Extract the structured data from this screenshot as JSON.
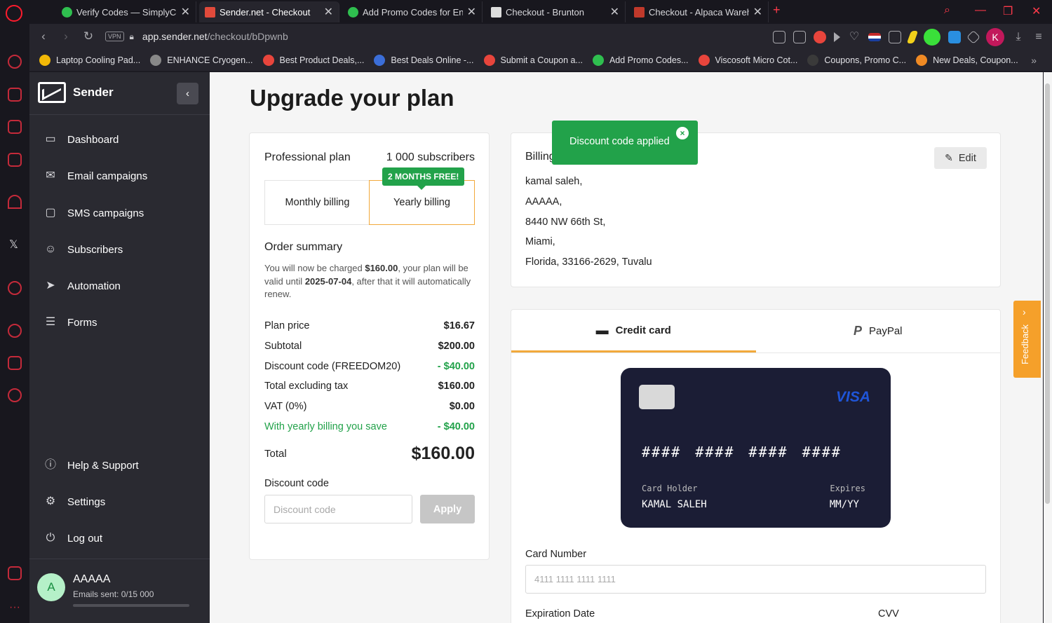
{
  "browser": {
    "tabs": [
      {
        "title": "Verify Codes — SimplyCodes",
        "favicon_color": "#2fbf4f"
      },
      {
        "title": "Sender.net - Checkout",
        "favicon_color": "#e14a3b"
      },
      {
        "title": "Add Promo Codes for Engine",
        "favicon_color": "#2fbf4f"
      },
      {
        "title": "Checkout - Brunton",
        "favicon_color": "#dddddd"
      },
      {
        "title": "Checkout - Alpaca Warehouse",
        "favicon_color": "#c0392b"
      }
    ],
    "new_tab": "+",
    "url_domain": "app.sender.net",
    "url_path": "/checkout/bDpwnb",
    "vpn": "VPN",
    "profile_initial": "K",
    "bookmarks": [
      {
        "label": "Laptop Cooling Pad...",
        "color": "#f2b807"
      },
      {
        "label": "ENHANCE Cryogen...",
        "color": "#888888"
      },
      {
        "label": "Best Product Deals,...",
        "color": "#e8453c"
      },
      {
        "label": "Best Deals Online -...",
        "color": "#3b6ed8"
      },
      {
        "label": "Submit a Coupon a...",
        "color": "#e8453c"
      },
      {
        "label": "Add Promo Codes...",
        "color": "#2fbf4f"
      },
      {
        "label": "Viscosoft Micro Cot...",
        "color": "#e8453c"
      },
      {
        "label": "Coupons, Promo C...",
        "color": "#3a3a3a"
      },
      {
        "label": "New Deals, Coupon...",
        "color": "#f08a24"
      }
    ],
    "more": "»"
  },
  "sidebar": {
    "brand": "Sender",
    "collapse": "‹",
    "items": [
      {
        "label": "Dashboard",
        "icon": "▭"
      },
      {
        "label": "Email campaigns",
        "icon": "✉"
      },
      {
        "label": "SMS campaigns",
        "icon": "▢"
      },
      {
        "label": "Subscribers",
        "icon": "☺"
      },
      {
        "label": "Automation",
        "icon": "➤"
      },
      {
        "label": "Forms",
        "icon": "☰"
      }
    ],
    "bottom_items": [
      {
        "label": "Help & Support",
        "icon": "ⓘ"
      },
      {
        "label": "Settings",
        "icon": "⚙"
      },
      {
        "label": "Log out",
        "icon": "⏻"
      }
    ],
    "user": {
      "initial": "A",
      "name": "AAAAA",
      "emails_sent": "Emails sent: 0/15 000",
      "usage_fraction": 0
    }
  },
  "page": {
    "title": "Upgrade your plan"
  },
  "plan": {
    "name": "Professional plan",
    "subscribers": "1 000 subscribers",
    "badge": "2 MONTHS FREE!",
    "monthly": "Monthly billing",
    "yearly": "Yearly billing",
    "selected": "yearly"
  },
  "order": {
    "title": "Order summary",
    "desc_1": "You will now be charged ",
    "desc_amount": "$160.00",
    "desc_2": ", your plan will be valid until ",
    "desc_date": "2025-07-04",
    "desc_3": ", after that it will automatically renew.",
    "rows": [
      {
        "label": "Plan price",
        "value": "$16.67"
      },
      {
        "label": "Subtotal",
        "value": "$200.00"
      },
      {
        "label": "Discount code (FREEDOM20)",
        "value": "- $40.00"
      },
      {
        "label": "Total excluding tax",
        "value": "$160.00"
      },
      {
        "label": "VAT (0%)",
        "value": "$0.00"
      },
      {
        "label": "With yearly billing you save",
        "value": "- $40.00"
      }
    ],
    "total_label": "Total",
    "total_value": "$160.00",
    "discount_label": "Discount code",
    "discount_placeholder": "Discount code",
    "apply": "Apply"
  },
  "billing": {
    "title": "Billing",
    "edit": "Edit",
    "lines": [
      "kamal saleh,",
      "AAAAA,",
      "8440 NW 66th St,",
      "Miami,",
      "Florida, 33166-2629, Tuvalu"
    ]
  },
  "toast": {
    "message": "Discount code applied",
    "close": "×"
  },
  "payment": {
    "tab_card": "Credit card",
    "tab_paypal": "PayPal",
    "card_brand": "VISA",
    "card_number": "#### #### #### ####",
    "holder_label": "Card Holder",
    "holder_name": "KAMAL SALEH",
    "expires_label": "Expires",
    "expires_value": "MM/YY",
    "card_number_label": "Card Number",
    "card_number_placeholder": "4111 1111 1111 1111",
    "expiration_label": "Expiration Date",
    "cvv_label": "CVV"
  },
  "feedback": {
    "label": "Feedback",
    "chevron": "›"
  }
}
